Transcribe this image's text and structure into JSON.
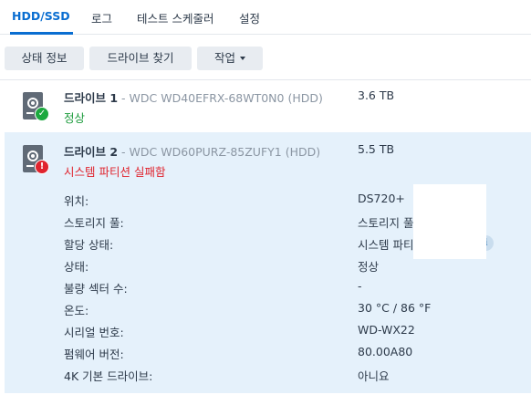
{
  "tabs": [
    {
      "label": "HDD/SSD",
      "active": true
    },
    {
      "label": "로그",
      "active": false
    },
    {
      "label": "테스트 스케줄러",
      "active": false
    },
    {
      "label": "설정",
      "active": false
    }
  ],
  "toolbar": {
    "status_info_label": "상태 정보",
    "find_drive_label": "드라이브 찾기",
    "action_label": "작업"
  },
  "drives": [
    {
      "name": "드라이브 1",
      "separator": " - ",
      "model": "WDC WD40EFRX-68WT0N0 (HDD)",
      "size": "3.6 TB",
      "status": "정상",
      "status_color": "#1a9a3a",
      "badge_icon": "check-icon"
    },
    {
      "name": "드라이브 2",
      "separator": " - ",
      "model": "WDC WD60PURZ-85ZUFY1 (HDD)",
      "size": "5.5 TB",
      "status": "시스템 파티션 실패함",
      "status_color": "#e0242e",
      "badge_icon": "exclamation-icon",
      "details": [
        {
          "label": "위치:",
          "value": "DS720+"
        },
        {
          "label": "스토리지 풀:",
          "value": "스토리지 풀 1"
        },
        {
          "label": "할당 상태:",
          "value": "시스템 파티션 실패함"
        },
        {
          "label": "상태:",
          "value": "정상"
        },
        {
          "label": "불량 섹터 수:",
          "value": "-"
        },
        {
          "label": "온도:",
          "value": "30 °C / 86 °F"
        },
        {
          "label": "시리얼 번호:",
          "value": "WD-WX22"
        },
        {
          "label": "펌웨어 버전:",
          "value": "80.00A80"
        },
        {
          "label": "4K 기본 드라이브:",
          "value": "아니요"
        }
      ]
    }
  ],
  "icons": {
    "check": "✓",
    "exclamation": "!",
    "info": "i"
  },
  "colors": {
    "accent": "#0a6ed1",
    "selected_row": "#e5f1fb",
    "ok": "#1a9a3a",
    "error": "#e0242e"
  }
}
